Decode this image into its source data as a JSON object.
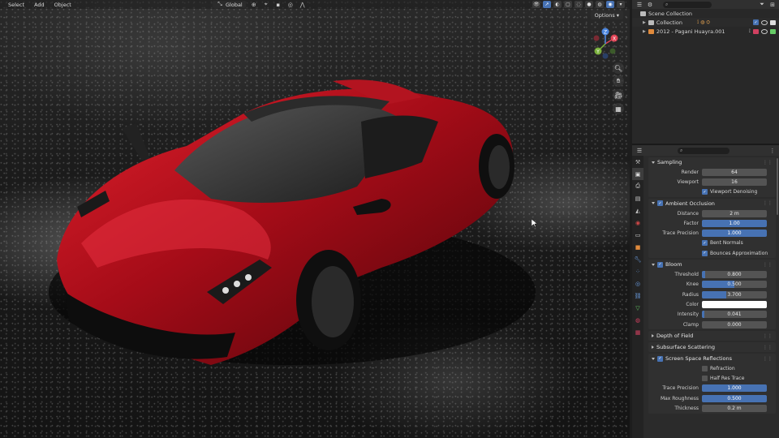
{
  "viewport": {
    "menu": [
      "Select",
      "Add",
      "Object"
    ],
    "orientation": "Global",
    "options_label": "Options",
    "gizmo_labels": {
      "x": "X",
      "y": "Y",
      "z": "Z"
    }
  },
  "outliner": {
    "rows": [
      {
        "label": "Scene Collection"
      },
      {
        "label": "Collection"
      },
      {
        "label": "2012 - Pagani Huayra.001"
      }
    ]
  },
  "properties": {
    "sampling": {
      "title": "Sampling",
      "render_label": "Render",
      "render_value": "64",
      "viewport_label": "Viewport",
      "viewport_value": "16",
      "denoise_label": "Viewport Denoising"
    },
    "ao": {
      "title": "Ambient Occlusion",
      "distance_label": "Distance",
      "distance_value": "2 m",
      "factor_label": "Factor",
      "factor_value": "1.00",
      "trace_label": "Trace Precision",
      "trace_value": "1.000",
      "bent_label": "Bent Normals",
      "bounce_label": "Bounces Approximation"
    },
    "bloom": {
      "title": "Bloom",
      "threshold_label": "Threshold",
      "threshold_value": "0.800",
      "threshold_fraction": 0.05,
      "knee_label": "Knee",
      "knee_value": "0.500",
      "knee_fraction": 0.5,
      "radius_label": "Radius",
      "radius_value": "3.700",
      "radius_fraction": 0.37,
      "color_label": "Color",
      "color_value": "#ffffff",
      "intensity_label": "Intensity",
      "intensity_value": "0.041",
      "intensity_fraction": 0.04,
      "clamp_label": "Clamp",
      "clamp_value": "0.000"
    },
    "dof": {
      "title": "Depth of Field"
    },
    "sss": {
      "title": "Subsurface Scattering"
    },
    "ssr": {
      "title": "Screen Space Reflections",
      "refraction_label": "Refraction",
      "halfres_label": "Half Res Trace",
      "trace_label": "Trace Precision",
      "trace_value": "1.000",
      "rough_label": "Max Roughness",
      "rough_value": "0.500",
      "thick_label": "Thickness",
      "thick_value": "0.2 m"
    }
  },
  "colors": {
    "accent": "#4772b3",
    "car_red": "#c01020",
    "panel_bg": "#303030"
  }
}
